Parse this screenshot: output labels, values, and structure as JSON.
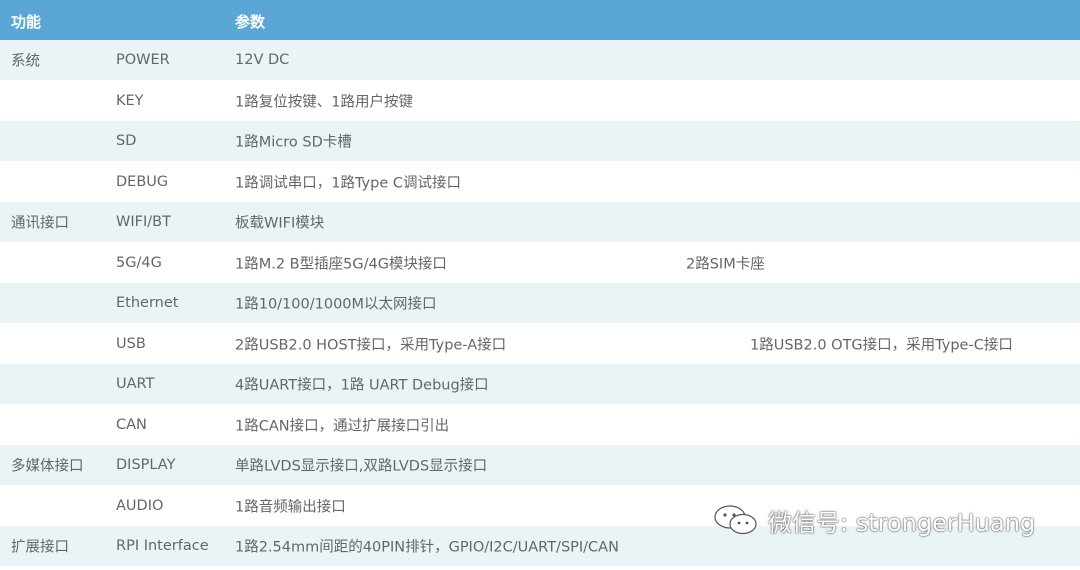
{
  "header": {
    "col_function": "功能",
    "col_params": "参数"
  },
  "rows": [
    {
      "category": "系统",
      "feature": "POWER",
      "param": "12V DC",
      "extra": ""
    },
    {
      "category": "",
      "feature": "KEY",
      "param": "1路复位按键、1路用户按键",
      "extra": ""
    },
    {
      "category": "",
      "feature": "SD",
      "param": "1路Micro SD卡槽",
      "extra": ""
    },
    {
      "category": "",
      "feature": "DEBUG",
      "param": "1路调试串口，1路Type C调试接口",
      "extra": ""
    },
    {
      "category": "通讯接口",
      "feature": "WIFI/BT",
      "param": "板载WIFI模块",
      "extra": ""
    },
    {
      "category": "",
      "feature": "5G/4G",
      "param": "1路M.2 B型插座5G/4G模块接口",
      "extra": "2路SIM卡座"
    },
    {
      "category": "",
      "feature": "Ethernet",
      "param": "1路10/100/1000M以太网接口",
      "extra": ""
    },
    {
      "category": "",
      "feature": "USB",
      "param": "2路USB2.0 HOST接口，采用Type-A接口",
      "extra": "1路USB2.0 OTG接口，采用Type-C接口"
    },
    {
      "category": "",
      "feature": "UART",
      "param": "4路UART接口，1路 UART Debug接口",
      "extra": ""
    },
    {
      "category": "",
      "feature": "CAN",
      "param": "1路CAN接口，通过扩展接口引出",
      "extra": ""
    },
    {
      "category": "多媒体接口",
      "feature": "DISPLAY",
      "param": "单路LVDS显示接口,双路LVDS显示接口",
      "extra": ""
    },
    {
      "category": "",
      "feature": "AUDIO",
      "param": "1路音频输出接口",
      "extra": ""
    },
    {
      "category": "扩展接口",
      "feature": "RPI Interface",
      "param": "1路2.54mm间距的40PIN排针，GPIO/I2C/UART/SPI/CAN",
      "extra": ""
    }
  ],
  "watermark": {
    "icon": "wechat-icon",
    "text": "微信号: strongerHuang"
  }
}
